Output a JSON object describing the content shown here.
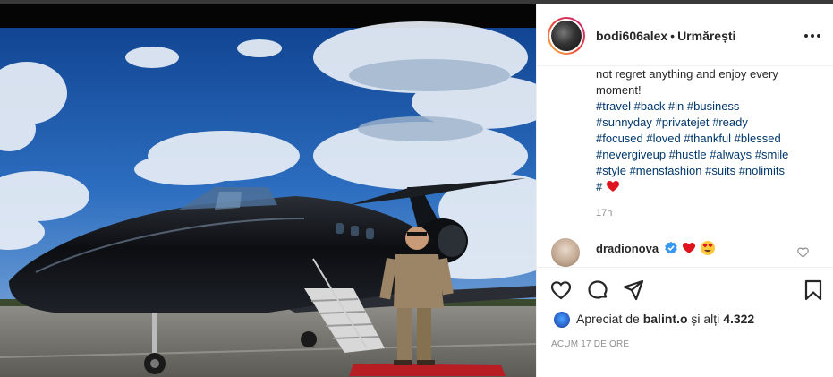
{
  "post": {
    "username": "bodi606alex",
    "separator": "•",
    "follow_label": "Urmărești",
    "more_label": "More options"
  },
  "caption": {
    "text_top": "not regret anything and enjoy every moment!",
    "hashtags": [
      "#travel #back #in #business",
      "#sunnyday #privatejet #ready",
      "#focused #loved #thankful #blessed",
      "#nevergiveup #hustle #always #smile",
      "#style #mensfashion #suits #nolimits",
      "#"
    ],
    "time": "17h"
  },
  "comment": {
    "username": "dradionova"
  },
  "likes": {
    "prefix": "Apreciat de",
    "user": "balint.o",
    "suffix": "și alți",
    "count": "4.322"
  },
  "timestamp": "ACUM 17 DE ORE",
  "colors": {
    "text": "#262626",
    "hashtag": "#00376b",
    "muted": "#8e8e8e",
    "verified": "#3897f0",
    "heart": "#ed4956"
  },
  "icons": [
    "more-icon",
    "heart-icon",
    "comment-icon",
    "share-icon",
    "bookmark-icon",
    "verified-icon",
    "like-comment-icon"
  ]
}
